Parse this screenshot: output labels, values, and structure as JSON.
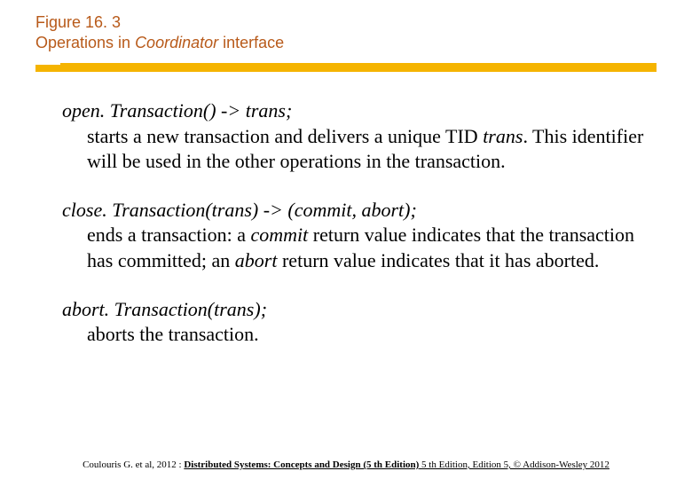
{
  "header": {
    "figure_number": "Figure 16. 3",
    "title_prefix": "Operations in ",
    "title_italic": "Coordinator",
    "title_suffix": " interface"
  },
  "ops": {
    "open": {
      "sig": "open. Transaction() -> trans;",
      "desc_a": "starts a new transaction and delivers a unique TID ",
      "desc_i1": "trans",
      "desc_b": ". This identifier will be used in the other operations in the transaction."
    },
    "close": {
      "sig": "close. Transaction(trans) -> (commit, abort);",
      "desc_a": "ends a transaction: a ",
      "desc_i1": "commit",
      "desc_b": " return value indicates that the transaction has  committed; an ",
      "desc_i2": "abort",
      "desc_c": " return value indicates that it  has aborted."
    },
    "abort": {
      "sig": "abort. Transaction(trans);",
      "desc_a": "aborts the transaction."
    }
  },
  "footer": {
    "lead": "Coulouris G. et al, 2012 : ",
    "bold": "Distributed Systems: Concepts and Design (5 th Edition)",
    "tail": " 5 th Edition, Edition 5, © Addison-Wesley 2012"
  }
}
